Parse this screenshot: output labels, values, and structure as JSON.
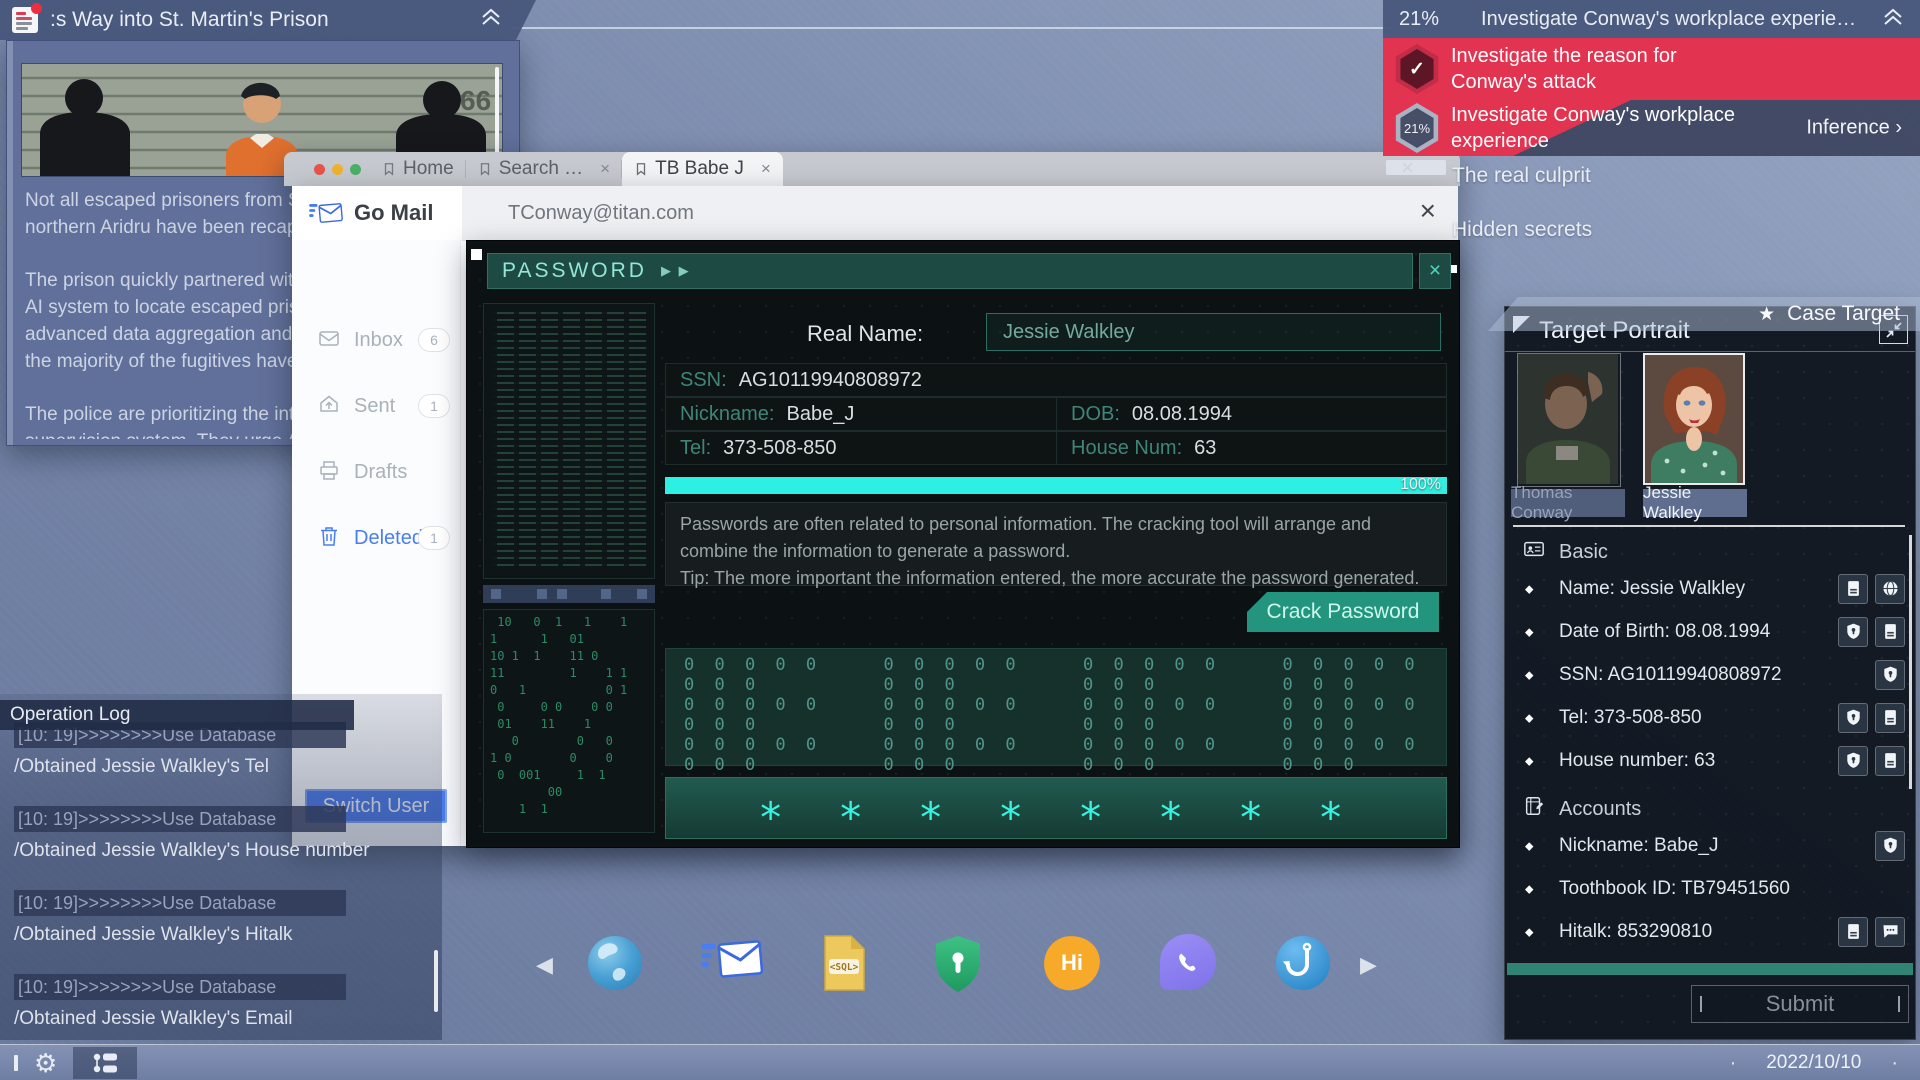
{
  "colors": {
    "task_red": "#e23450",
    "accent_blue": "#4a7df0",
    "cyan_progress": "#2ef0e2",
    "teal_button": "#23957f",
    "green_bar": "#2f8473"
  },
  "topbar": {
    "news_title": ":s Way into St. Martin's Prison",
    "task_progress": "21%",
    "task_title": "Investigate Conway's workplace experie…"
  },
  "tasks": {
    "completed": {
      "check": "✓",
      "text": "Investigate the reason for\nConway's attack"
    },
    "active": {
      "badge": "21%",
      "text": "Investigate Conway's workplace\nexperience",
      "action": "Inference",
      "arrow": "›"
    },
    "clues": [
      "The real culprit",
      "Hidden secrets"
    ],
    "case_target_label": "Case Target",
    "star": "★"
  },
  "news": {
    "photo_tag": "66",
    "paragraphs": [
      "Not all escaped prisoners from St\nnorthern Aridru have been recap",
      "The prison quickly partnered with\nAI system to locate escaped priso\nadvanced data aggregation and\nthe majority of the fugitives have",
      "The police are prioritizing the inte\nsupervision system. They urge Ar"
    ]
  },
  "browser": {
    "close_window": "×",
    "tabs": [
      {
        "label": "Home",
        "closable": false,
        "active": false
      },
      {
        "label": "Search …",
        "closable": true,
        "active": false
      },
      {
        "label": "TB Babe J",
        "closable": true,
        "active": true
      }
    ]
  },
  "mail": {
    "app_name": "Go Mail",
    "account": "TConway@titan.com",
    "close": "×",
    "folders": [
      {
        "key": "inbox",
        "label": "Inbox",
        "count": "6",
        "active": false
      },
      {
        "key": "sent",
        "label": "Sent",
        "count": "1",
        "active": false
      },
      {
        "key": "drafts",
        "label": "Drafts",
        "count": "",
        "active": false
      },
      {
        "key": "deleted",
        "label": "Deleted",
        "count": "1",
        "active": true
      }
    ],
    "switch_user": "Switch User"
  },
  "cracker": {
    "title": "PASSWORD",
    "close": "×",
    "real_name_label": "Real Name:",
    "real_name_value": "Jessie Walkley",
    "ssn_label": "SSN:",
    "ssn": "AG10119940808972",
    "nickname_label": "Nickname:",
    "nickname": "Babe_J",
    "dob_label": "DOB:",
    "dob": "08.08.1994",
    "tel_label": "Tel:",
    "tel": "373-508-850",
    "house_label": "House Num:",
    "house": "63",
    "progress_label": "100%",
    "description": "Passwords are often related to personal information. The cracking tool will arrange and\ncombine the information to generate a password.\nTip: The more important the information entered, the more accurate the password generated.",
    "crack_button": "Crack Password",
    "zero_symbol": "0",
    "zero_rows": 4,
    "zero_groups": 4,
    "zeros_per_group": 8,
    "mask_symbol": "*",
    "mask_count": 8
  },
  "target": {
    "title": "Target Portrait",
    "bullet": "◆",
    "portraits": [
      {
        "name": "Thomas Conway",
        "dimmed": true
      },
      {
        "name": "Jessie Walkley",
        "dimmed": false
      }
    ],
    "sections": [
      {
        "icon": "id-card",
        "title": "Basic",
        "rows": [
          {
            "text": "Name: Jessie Walkley",
            "icons": [
              "file",
              "globe"
            ]
          },
          {
            "text": "Date of Birth: 08.08.1994",
            "icons": [
              "shield",
              "file"
            ]
          },
          {
            "text": "SSN: AG10119940808972",
            "icons": [
              "shield"
            ]
          },
          {
            "text": "Tel: 373-508-850",
            "icons": [
              "shield",
              "file"
            ]
          },
          {
            "text": "House number: 63",
            "icons": [
              "shield",
              "file"
            ]
          }
        ]
      },
      {
        "icon": "notebook",
        "title": "Accounts",
        "rows": [
          {
            "text": "Nickname: Babe_J",
            "icons": [
              "shield"
            ]
          },
          {
            "text": "Toothbook ID: TB79451560",
            "icons": []
          },
          {
            "text": "Hitalk: 853290810",
            "icons": [
              "file",
              "chat"
            ]
          }
        ]
      }
    ],
    "submit": "Submit"
  },
  "oplog": {
    "title": "Operation Log",
    "entries": [
      {
        "head": "[10: 19]>>>>>>>>Use Database",
        "detail": "/Obtained Jessie Walkley's Tel"
      },
      {
        "head": "[10: 19]>>>>>>>>Use Database",
        "detail": "/Obtained Jessie Walkley's House number"
      },
      {
        "head": "[10: 19]>>>>>>>>Use Database",
        "detail": "/Obtained Jessie Walkley's Hitalk"
      },
      {
        "head": "[10: 19]>>>>>>>>Use Database",
        "detail": "/Obtained Jessie Walkley's Email"
      }
    ]
  },
  "dock": {
    "icons": [
      {
        "name": "prev",
        "glyph": "◀"
      },
      {
        "name": "browser"
      },
      {
        "name": "mail"
      },
      {
        "name": "sql",
        "label": "<SQL>"
      },
      {
        "name": "shield"
      },
      {
        "name": "hitalk",
        "label": "Hi"
      },
      {
        "name": "phone"
      },
      {
        "name": "hook"
      },
      {
        "name": "next",
        "glyph": "▶"
      }
    ]
  },
  "taskbar": {
    "date": "2022/10/10",
    "dot": "·"
  }
}
